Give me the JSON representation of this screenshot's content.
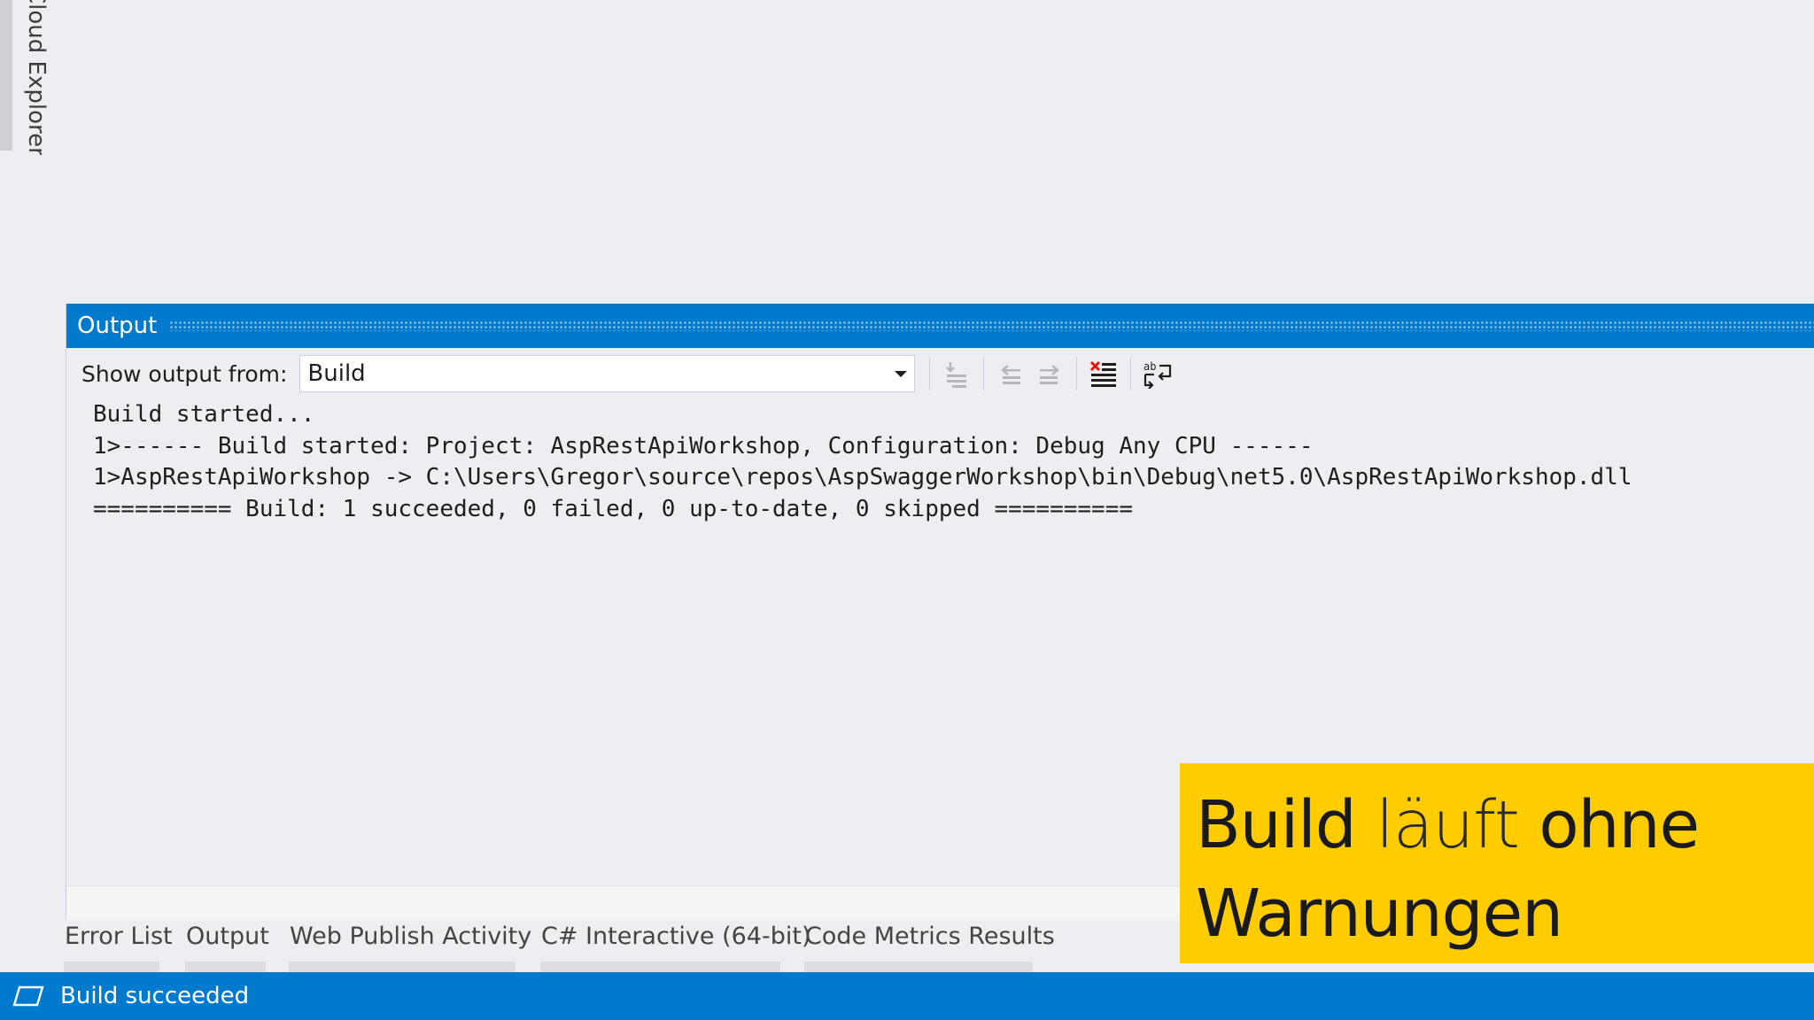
{
  "side_tab": {
    "label": "Cloud Explorer"
  },
  "output_panel": {
    "title": "Output",
    "show_output_from_label": "Show output from:",
    "source_selected": "Build",
    "toolbar_icons": [
      "go-to-error-icon",
      "previous-message-icon",
      "next-message-icon",
      "clear-all-icon",
      "toggle-word-wrap-icon"
    ],
    "lines": [
      "Build started...",
      "1>------ Build started: Project: AspRestApiWorkshop, Configuration: Debug Any CPU ------",
      "1>AspRestApiWorkshop -> C:\\Users\\Gregor\\source\\repos\\AspSwaggerWorkshop\\bin\\Debug\\net5.0\\AspRestApiWorkshop.dll",
      "========== Build: 1 succeeded, 0 failed, 0 up-to-date, 0 skipped =========="
    ]
  },
  "bottom_tabs": [
    "Error List",
    "Output",
    "Web Publish Activity",
    "C# Interactive (64-bit)",
    "Code Metrics Results"
  ],
  "caption": {
    "word1": "Build",
    "word2": "läuft",
    "word3": "ohne",
    "word4": "Warnungen",
    "background": "#ffcc00"
  },
  "status_bar": {
    "text": "Build succeeded",
    "icon": "build-status-icon"
  },
  "colors": {
    "accent": "#007acc",
    "background": "#eeeef2"
  }
}
